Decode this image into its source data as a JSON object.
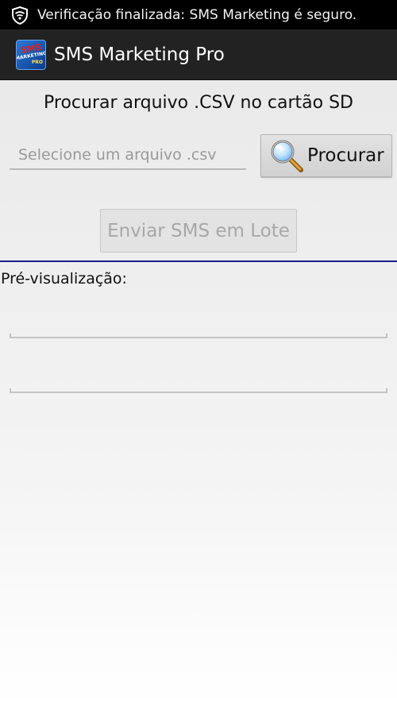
{
  "status_bar": {
    "icon": "shield-check-icon",
    "text": "Verificação finalizada: SMS Marketing é seguro."
  },
  "action_bar": {
    "app_icon": {
      "line1": "SMS",
      "line2": "MARKETING",
      "line3": "PRO"
    },
    "title": "SMS Marketing Pro"
  },
  "main": {
    "heading": "Procurar arquivo .CSV no cartão SD",
    "file_input": {
      "placeholder": "Selecione um arquivo .csv",
      "value": ""
    },
    "browse_button": {
      "label": "Procurar",
      "icon": "magnifying-glass-icon"
    },
    "send_button": {
      "label": "Enviar SMS em Lote",
      "enabled": false
    },
    "preview": {
      "label": "Pré-visualização:",
      "fields": [
        "",
        ""
      ]
    }
  },
  "colors": {
    "status_bar_bg": "#000000",
    "action_bar_bg": "#222222",
    "divider": "#1a1a8a"
  }
}
